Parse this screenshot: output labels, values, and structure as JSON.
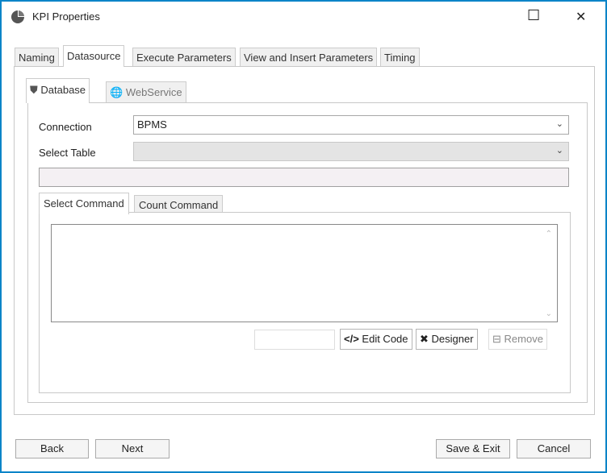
{
  "window": {
    "title": "KPI Properties",
    "maximize": "☐",
    "close": "✕"
  },
  "tabs": [
    "Naming",
    "Datasource",
    "Execute Parameters",
    "View and Insert Parameters",
    "Timing"
  ],
  "subtabs": [
    "Database",
    "WebService"
  ],
  "form": {
    "connection_label": "Connection",
    "connection_value": "BPMS",
    "table_label": "Select Table",
    "table_value": ""
  },
  "cmdtabs": [
    "Select Command",
    "Count Command"
  ],
  "toolbar": {
    "edit_code": "Edit Code",
    "designer": "Designer",
    "remove": "Remove"
  },
  "footer": {
    "back": "Back",
    "next": "Next",
    "save_exit": "Save & Exit",
    "cancel": "Cancel"
  }
}
